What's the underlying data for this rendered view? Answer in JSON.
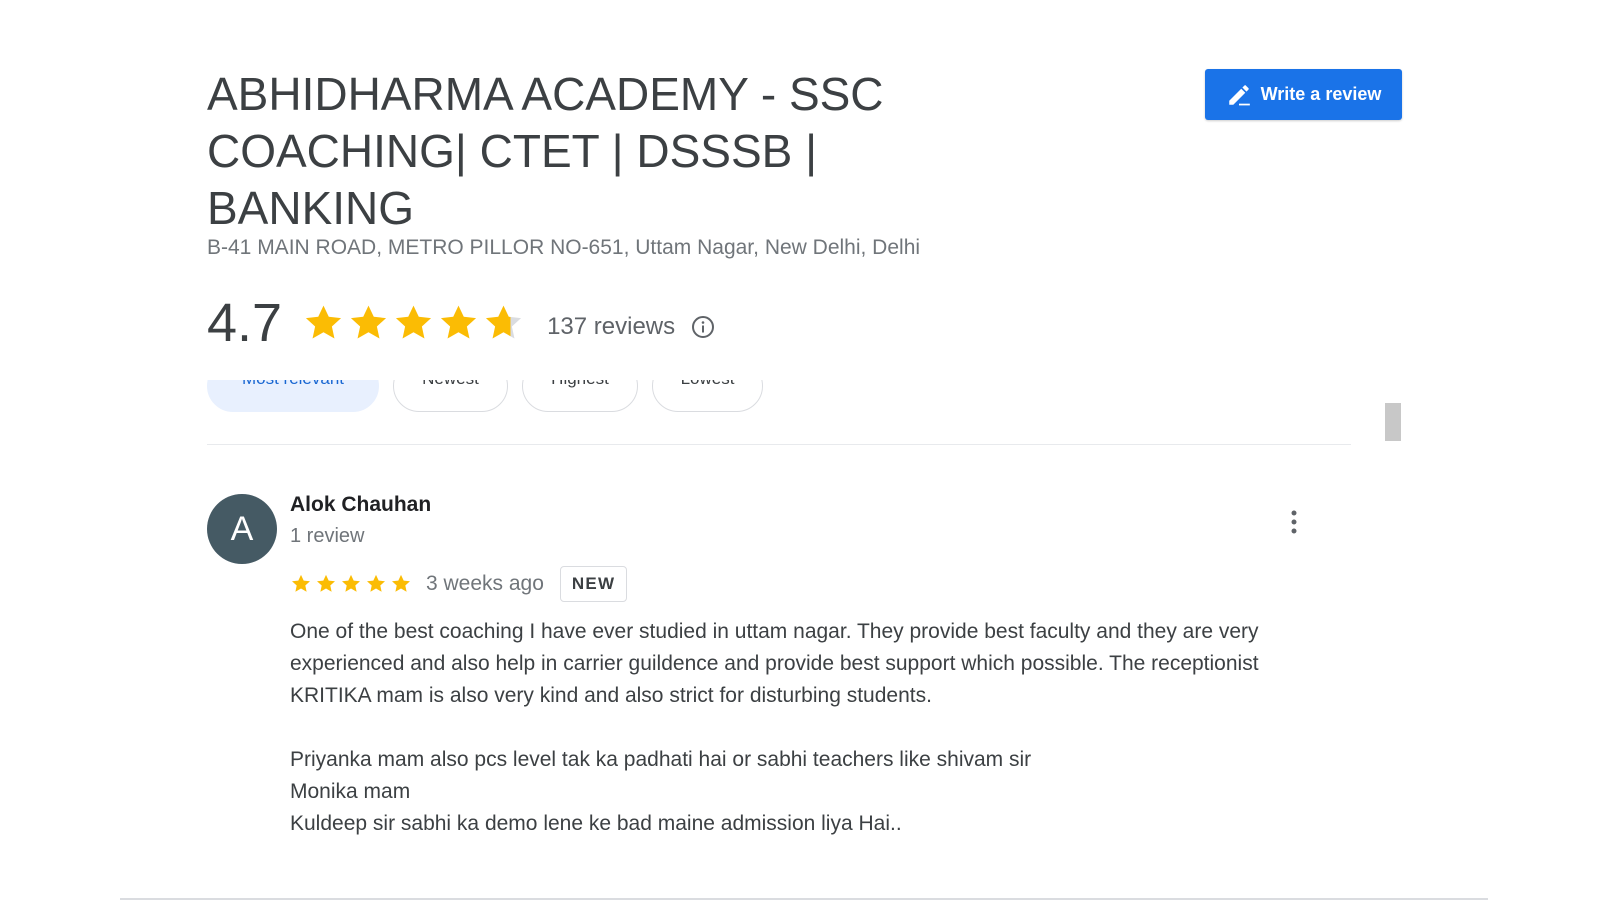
{
  "place": {
    "title": "ABHIDHARMA ACADEMY - SSC COACHING| CTET | DSSSB | BANKING",
    "address": "B-41 MAIN ROAD, METRO PILLOR NO-651, Uttam Nagar, New Delhi, Delhi",
    "rating": "4.7",
    "rating_value": 4.7,
    "reviews_count": "137 reviews"
  },
  "actions": {
    "write_review_label": "Write a review"
  },
  "sort_chips": [
    {
      "label": "Most relevant",
      "active": true
    },
    {
      "label": "Newest",
      "active": false
    },
    {
      "label": "Highest",
      "active": false
    },
    {
      "label": "Lowest",
      "active": false
    }
  ],
  "review": {
    "avatar_letter": "A",
    "author": "Alok Chauhan",
    "author_meta": "1 review",
    "stars": 5,
    "time": "3 weeks ago",
    "badge": "NEW",
    "paragraphs": [
      "One of the best coaching I have ever studied  in uttam nagar. They provide best faculty and they are very experienced and also help in carrier guildence and provide best support which possible. The receptionist KRITIKA mam is also very kind and also strict for disturbing students.",
      "",
      "Priyanka mam also pcs level tak ka padhati hai or sabhi teachers like shivam sir",
      "Monika mam",
      "Kuldeep sir sabhi ka demo lene ke bad maine admission liya Hai.."
    ]
  },
  "icons": {
    "write": "pencil-icon",
    "info": "info-icon",
    "more": "more-vert-icon",
    "star": "star-icon"
  },
  "colors": {
    "accent": "#1a73e8",
    "star": "#fbbc04",
    "star_empty": "#dadce0",
    "avatar_bg": "#455a64",
    "chip_active_bg": "#e8f0fe"
  }
}
